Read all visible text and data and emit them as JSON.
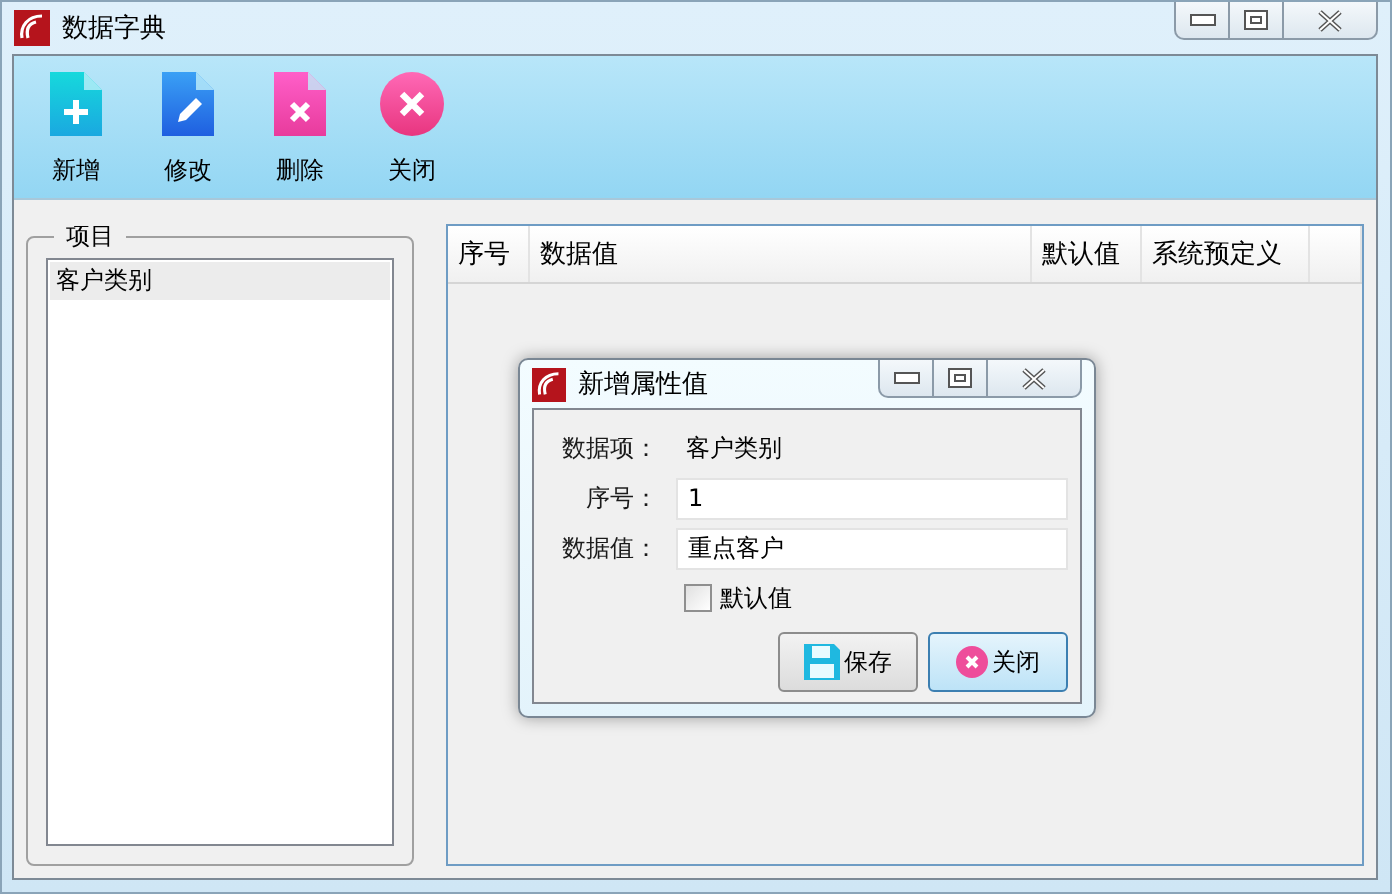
{
  "window": {
    "title": "数据字典"
  },
  "toolbar": [
    {
      "label": "新增",
      "kind": "add"
    },
    {
      "label": "修改",
      "kind": "edit"
    },
    {
      "label": "删除",
      "kind": "delete"
    },
    {
      "label": "关闭",
      "kind": "close"
    }
  ],
  "categories": {
    "title": "项目",
    "items": [
      {
        "label": "客户类别",
        "selected": true
      }
    ]
  },
  "grid": {
    "columns": [
      "序号",
      "数据值",
      "默认值",
      "系统预定义"
    ]
  },
  "dialog": {
    "title": "新增属性值",
    "fields": [
      {
        "label": "数据项：",
        "kind": "text",
        "value": "客户类别"
      },
      {
        "label": "序号：",
        "kind": "input",
        "value": "1"
      },
      {
        "label": "数据值：",
        "kind": "input",
        "value": "重点客户"
      }
    ],
    "default_checkbox": {
      "label": "默认值",
      "checked": false
    },
    "buttons": [
      {
        "label": "保存",
        "kind": "save"
      },
      {
        "label": "关闭",
        "kind": "close"
      }
    ]
  }
}
